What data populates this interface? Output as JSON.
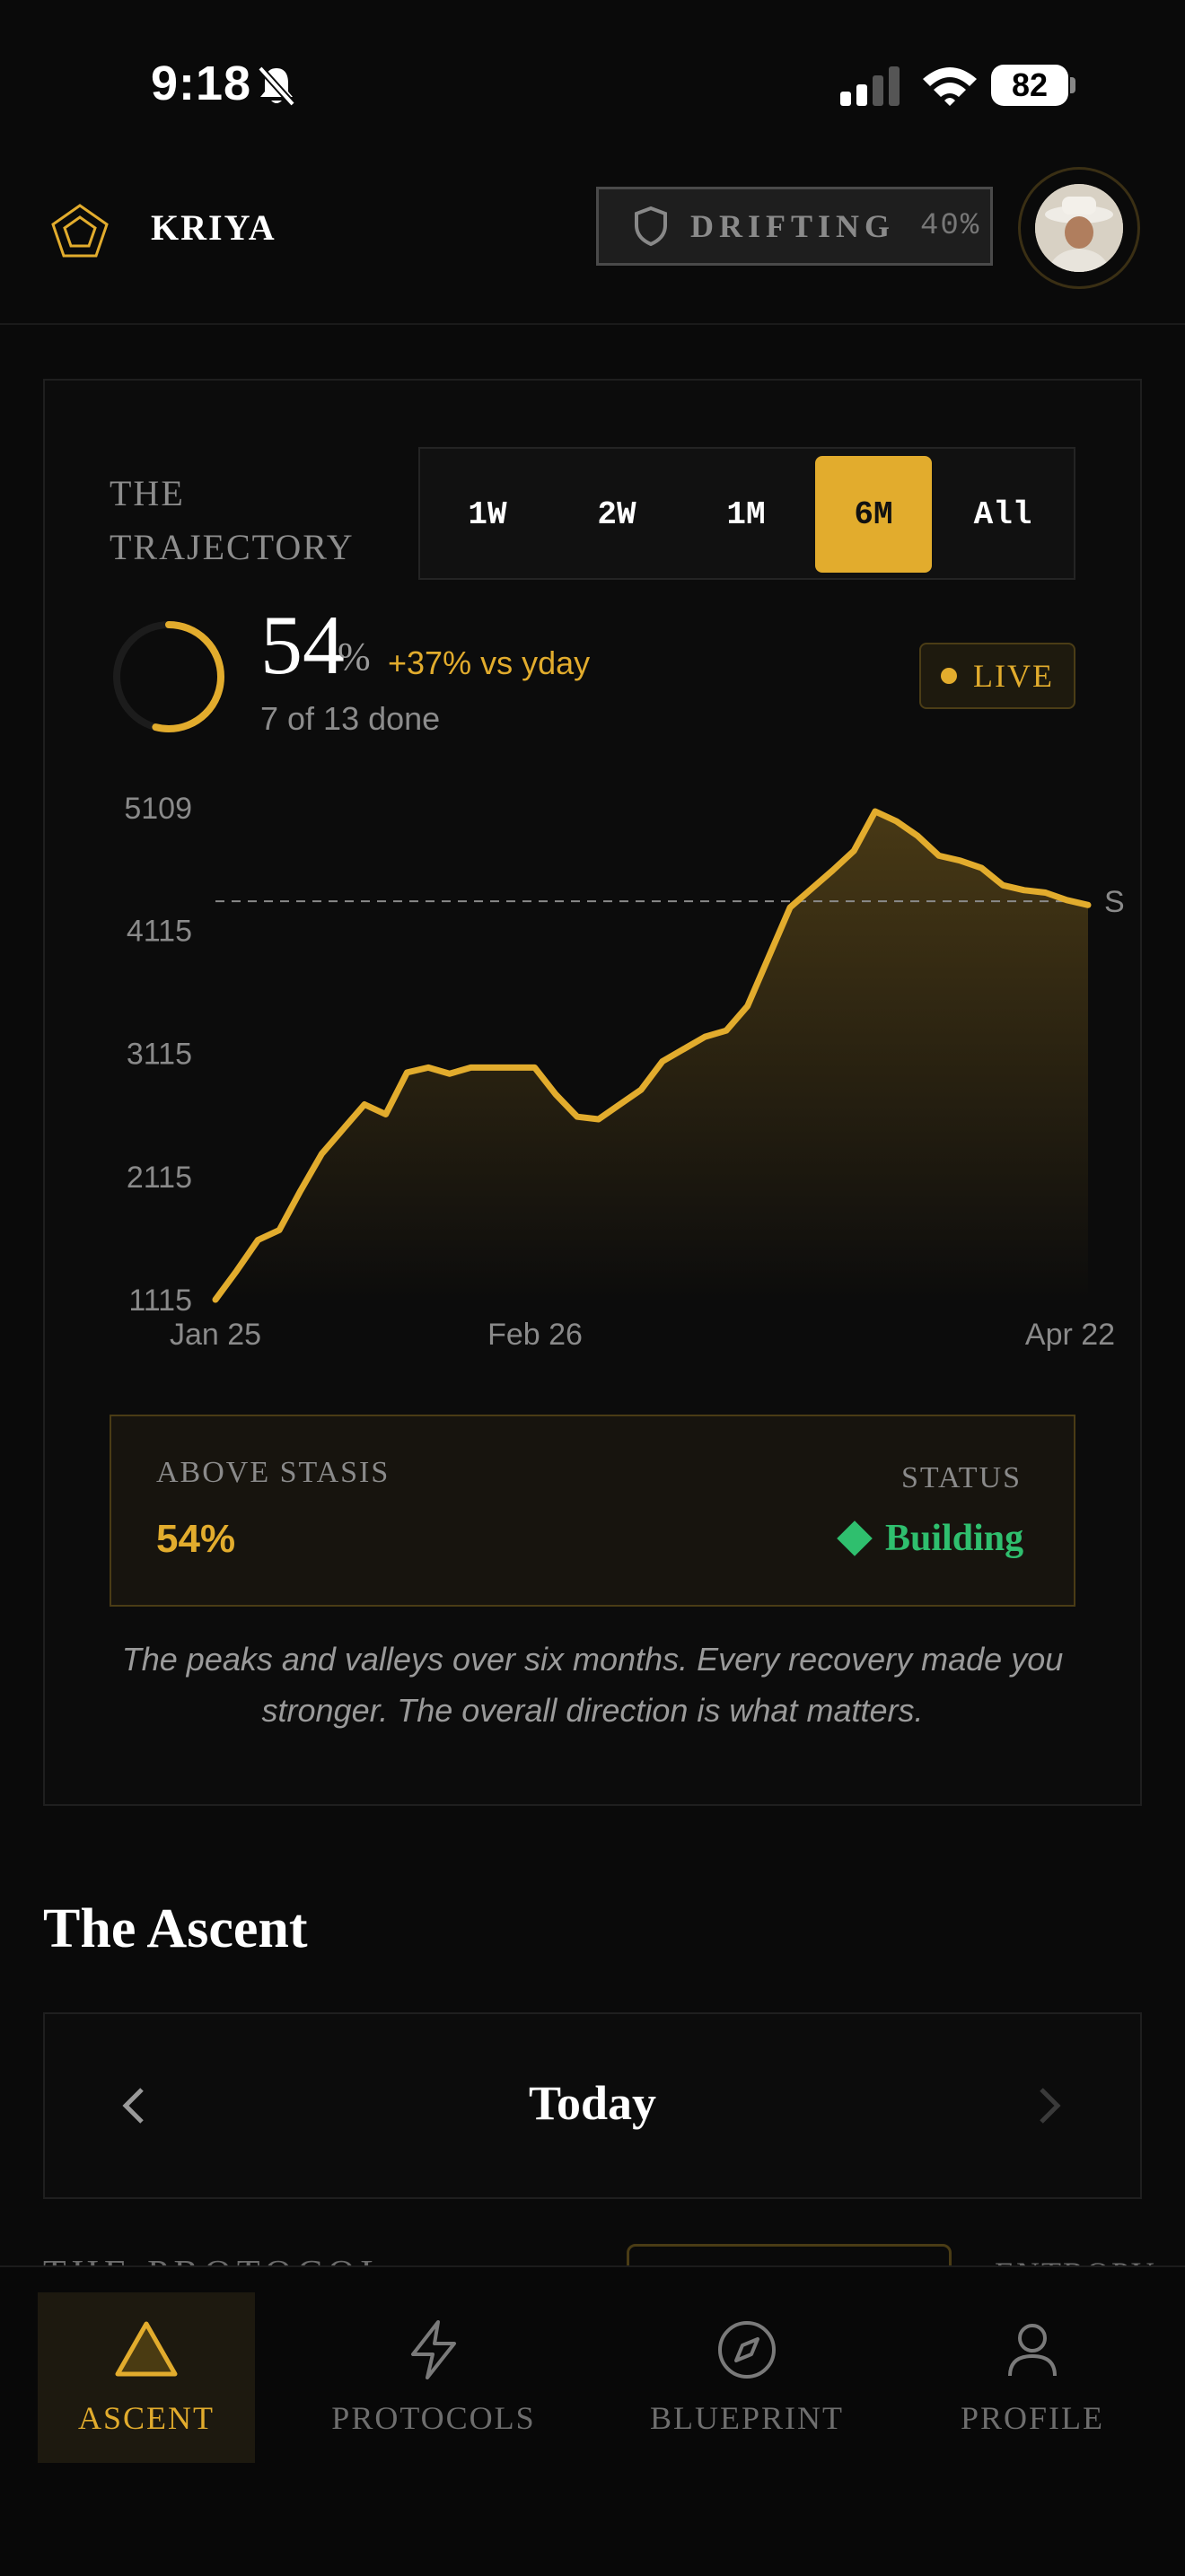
{
  "status_bar": {
    "time": "9:18",
    "battery": "82"
  },
  "header": {
    "brand": "KRIYA",
    "pill_label": "DRIFTING",
    "pill_value": "40%"
  },
  "trajectory": {
    "title": "THE TRAJECTORY",
    "ranges": [
      "1W",
      "2W",
      "1M",
      "6M",
      "All"
    ],
    "active_range": "6M",
    "percent": "54",
    "percent_sign": "%",
    "delta": "+37% vs yday",
    "done": "7 of 13 done",
    "live": "LIVE",
    "progress_fraction": 0.54
  },
  "chart_data": {
    "type": "line",
    "yticks": [
      "5109",
      "4115",
      "3115",
      "2115",
      "1115"
    ],
    "ylim": [
      1115,
      5109
    ],
    "xticks": [
      "Jan 25",
      "Feb 26",
      "Apr 22"
    ],
    "reference_line": {
      "value": 4350,
      "label": "S"
    },
    "series": [
      {
        "values": [
          1115,
          1350,
          1600,
          1680,
          2000,
          2300,
          2500,
          2700,
          2620,
          2960,
          3000,
          2950,
          3000,
          3000,
          3000,
          3000,
          2780,
          2600,
          2580,
          2700,
          2820,
          3050,
          3150,
          3250,
          3300,
          3500,
          3900,
          4300,
          4450,
          4600,
          4760,
          5080,
          5000,
          4880,
          4720,
          4680,
          4620,
          4480,
          4440,
          4420,
          4360,
          4320
        ]
      }
    ],
    "color": "#e2ac2d"
  },
  "stasis": {
    "label": "ABOVE STASIS",
    "value": "54%",
    "status_label": "STATUS",
    "status_value": "Building"
  },
  "caption": "The peaks and valleys over six months. Every recovery made you stronger. The overall direction is what matters.",
  "ascent": {
    "title": "The Ascent",
    "day": "Today"
  },
  "peek": {
    "left": "THE PROTOCOL",
    "right": "ENTROPY"
  },
  "tabs": [
    {
      "label": "ASCENT",
      "icon": "triangle-icon"
    },
    {
      "label": "PROTOCOLS",
      "icon": "bolt-icon"
    },
    {
      "label": "BLUEPRINT",
      "icon": "compass-icon"
    },
    {
      "label": "PROFILE",
      "icon": "user-icon"
    }
  ],
  "colors": {
    "accent": "#e2ac2d",
    "success": "#2fbf6e",
    "bg": "#0a0a0a"
  }
}
